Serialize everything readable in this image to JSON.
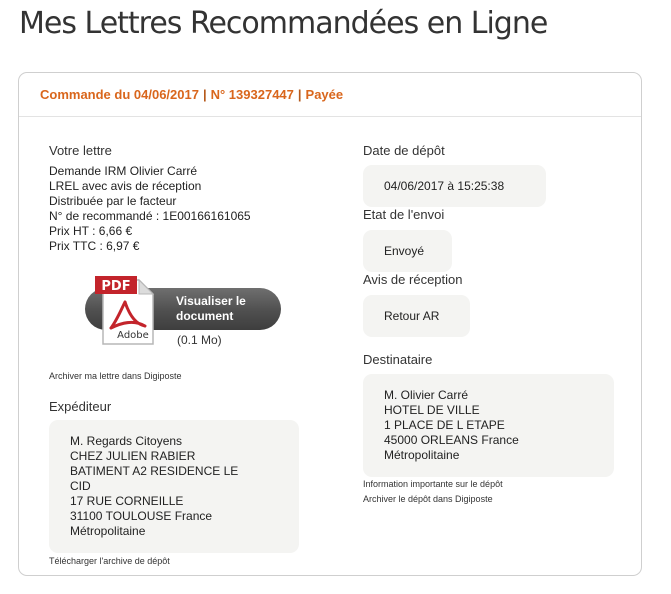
{
  "page": {
    "title": "Mes Lettres Recommandées en Ligne"
  },
  "order": {
    "date_label": "Commande du 04/06/2017",
    "separator": "|",
    "number_label": "N° 139327447",
    "status": "Payée"
  },
  "letter": {
    "heading": "Votre lettre",
    "lines": [
      "Demande IRM Olivier Carré",
      "LREL avec avis de réception",
      "Distribuée par le facteur",
      "N° de recommandé : 1E00166161065",
      "Prix HT : 6,66 €",
      "Prix TTC : 6,97 €"
    ],
    "pdf_badge": "PDF",
    "pdf_brand": "Adobe",
    "view_button_line1": "Visualiser le",
    "view_button_line2": "document",
    "file_size": "(0.1 Mo)",
    "archive_link": "Archiver ma lettre dans Digiposte"
  },
  "sender": {
    "heading": "Expéditeur",
    "lines": [
      "M. Regards Citoyens",
      "CHEZ JULIEN RABIER",
      "BATIMENT A2 RESIDENCE LE",
      "CID",
      "17 RUE CORNEILLE",
      "31100 TOULOUSE France",
      "Métropolitaine"
    ],
    "download_link": "Télécharger l'archive de dépôt"
  },
  "deposit": {
    "heading": "Date de dépôt",
    "value": "04/06/2017 à 15:25:38"
  },
  "sending_state": {
    "heading": "Etat de l'envoi",
    "value": "Envoyé"
  },
  "receipt": {
    "heading": "Avis de réception",
    "value": "Retour AR"
  },
  "recipient": {
    "heading": "Destinataire",
    "lines": [
      "M. Olivier Carré",
      "HOTEL DE VILLE",
      "1 PLACE DE L ETAPE",
      "45000 ORLEANS France",
      "Métropolitaine"
    ],
    "info_link": "Information importante sur le dépôt",
    "archive_link": "Archiver le dépôt dans Digiposte"
  },
  "colors": {
    "accent": "#d9661c",
    "box_bg": "#f4f4f2",
    "button_bg": "#4f4f4f",
    "pdf_red": "#c3242b"
  },
  "icons": {
    "pdf": "pdf-file-icon"
  }
}
